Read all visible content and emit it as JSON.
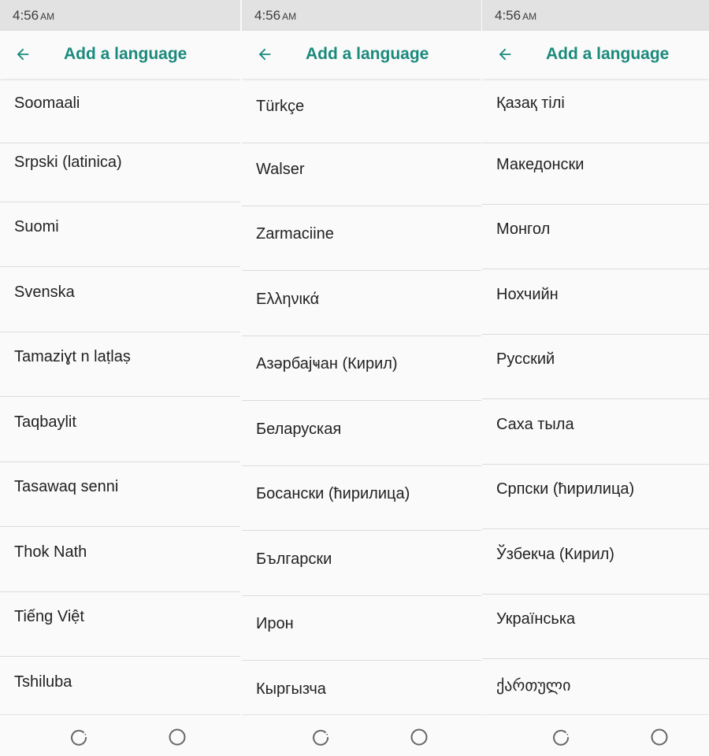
{
  "colors": {
    "accent": "#1a8a7c",
    "status_bar": "#e2e2e2",
    "background": "#fafafa"
  },
  "screens": [
    {
      "status": {
        "time": "4:56",
        "ampm": "AM"
      },
      "title": "Add a language",
      "languages": [
        "Soomaali",
        "Srpski (latinica)",
        "Suomi",
        "Svenska",
        "Tamaziɣt n laṭlaṣ",
        "Taqbaylit",
        "Tasawaq senni",
        "Thok Nath",
        "Tiếng Việt",
        "Tshiluba"
      ]
    },
    {
      "status": {
        "time": "4:56",
        "ampm": "AM"
      },
      "title": "Add a language",
      "languages": [
        "Türkçe",
        "Walser",
        "Zarmaciine",
        "Ελληνικά",
        "Азәрбајҹан (Кирил)",
        "Беларуская",
        "Босански (ћирилица)",
        "Български",
        "Ирон",
        "Кыргызча"
      ]
    },
    {
      "status": {
        "time": "4:56",
        "ampm": "AM"
      },
      "title": "Add a language",
      "languages": [
        "Қазақ тілі",
        "Македонски",
        "Монгол",
        "Нохчийн",
        "Русский",
        "Саха тыла",
        "Српски (ћирилица)",
        "Ўзбекча (Кирил)",
        "Українська",
        "ქართული"
      ]
    }
  ],
  "icons": {
    "back": "arrow-left-icon",
    "recents": "recents-icon",
    "home": "home-icon"
  }
}
